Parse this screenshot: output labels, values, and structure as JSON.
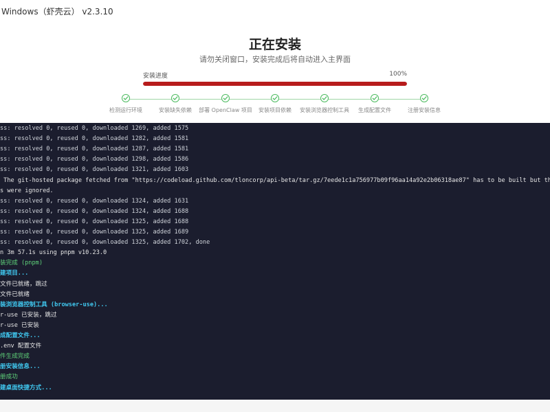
{
  "window": {
    "title": "Windows（虾壳云） v2.3.10"
  },
  "install": {
    "heading": "正在安装",
    "subheading": "请勿关闭窗口，安装完成后将自动进入主界面",
    "progress_label": "安装进度",
    "progress_text": "100%",
    "progress_value": 1.0,
    "accent_color": "#b71c1c",
    "steps": [
      {
        "label": "检测运行环境",
        "status": "done",
        "icon": "check-circle-icon"
      },
      {
        "label": "安装缺失依赖",
        "status": "done",
        "icon": "check-circle-icon"
      },
      {
        "label": "部署 OpenClaw 项目",
        "status": "done",
        "icon": "check-circle-icon"
      },
      {
        "label": "安装项目依赖",
        "status": "done",
        "icon": "check-circle-icon"
      },
      {
        "label": "安装浏览器控制工具",
        "status": "done",
        "icon": "check-circle-icon"
      },
      {
        "label": "生成配置文件",
        "status": "done",
        "icon": "check-circle-icon"
      },
      {
        "label": "注册安装信息",
        "status": "done",
        "icon": "check-circle-icon"
      }
    ]
  },
  "terminal": {
    "background": "#1b1d2e",
    "lines": [
      {
        "text": "ss: resolved 0, reused 0, downloaded 1269, added 1575",
        "style": "gray"
      },
      {
        "text": "ss: resolved 0, reused 0, downloaded 1282, added 1581",
        "style": "gray"
      },
      {
        "text": "ss: resolved 0, reused 0, downloaded 1287, added 1581",
        "style": "gray"
      },
      {
        "text": "ss: resolved 0, reused 0, downloaded 1298, added 1586",
        "style": "gray"
      },
      {
        "text": "ss: resolved 0, reused 0, downloaded 1321, added 1603",
        "style": "gray"
      },
      {
        "text": " The git-hosted package fetched from \"https://codeload.github.com/tloncorp/api-beta/tar.gz/7eede1c1a756977b09f96aa14a92e2b06318ae87\" has to be built but the build",
        "style": "white"
      },
      {
        "text": "s were ignored.",
        "style": "white"
      },
      {
        "text": "ss: resolved 0, reused 0, downloaded 1324, added 1631",
        "style": "gray"
      },
      {
        "text": "ss: resolved 0, reused 0, downloaded 1324, added 1688",
        "style": "gray"
      },
      {
        "text": "ss: resolved 0, reused 0, downloaded 1325, added 1688",
        "style": "gray"
      },
      {
        "text": "ss: resolved 0, reused 0, downloaded 1325, added 1689",
        "style": "gray"
      },
      {
        "text": "ss: resolved 0, reused 0, downloaded 1325, added 1702, done",
        "style": "gray"
      },
      {
        "text": "n 3m 57.1s using pnpm v10.23.0",
        "style": "white"
      },
      {
        "text": "装完成 (pnpm)",
        "style": "green"
      },
      {
        "text": "建项目...",
        "style": "cyan"
      },
      {
        "text": "文件已就绪，跳过",
        "style": "white"
      },
      {
        "text": "文件已就绪",
        "style": "white"
      },
      {
        "text": "装浏览器控制工具 (browser-use)...",
        "style": "cyan"
      },
      {
        "text": "r-use 已安装，跳过",
        "style": "white"
      },
      {
        "text": "r-use 已安装",
        "style": "white"
      },
      {
        "text": "成配置文件...",
        "style": "cyan"
      },
      {
        "text": ".env 配置文件",
        "style": "white"
      },
      {
        "text": "件生成完成",
        "style": "green"
      },
      {
        "text": "册安装信息...",
        "style": "cyan"
      },
      {
        "text": "册成功",
        "style": "green"
      },
      {
        "text": "建桌面快捷方式...",
        "style": "cyan"
      }
    ]
  }
}
